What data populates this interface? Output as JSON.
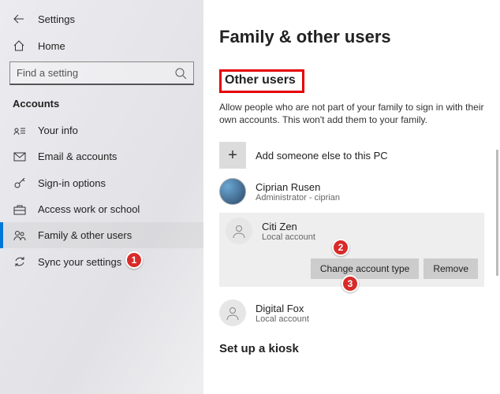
{
  "header": {
    "title": "Settings"
  },
  "search": {
    "placeholder": "Find a setting"
  },
  "home_label": "Home",
  "section_label": "Accounts",
  "nav": {
    "items": [
      {
        "label": "Your info"
      },
      {
        "label": "Email & accounts"
      },
      {
        "label": "Sign-in options"
      },
      {
        "label": "Access work or school"
      },
      {
        "label": "Family & other users"
      },
      {
        "label": "Sync your settings"
      }
    ]
  },
  "main": {
    "title": "Family & other users",
    "other_users_heading": "Other users",
    "other_users_desc": "Allow people who are not part of your family to sign in with their own accounts. This won't add them to your family.",
    "add_label": "Add someone else to this PC",
    "users": [
      {
        "name": "Ciprian Rusen",
        "sub": "Administrator - ciprian"
      },
      {
        "name": "Citi Zen",
        "sub": "Local account"
      },
      {
        "name": "Digital Fox",
        "sub": "Local account"
      }
    ],
    "change_type_label": "Change account type",
    "remove_label": "Remove",
    "kiosk_heading": "Set up a kiosk"
  },
  "annotations": {
    "b1": "1",
    "b2": "2",
    "b3": "3"
  }
}
